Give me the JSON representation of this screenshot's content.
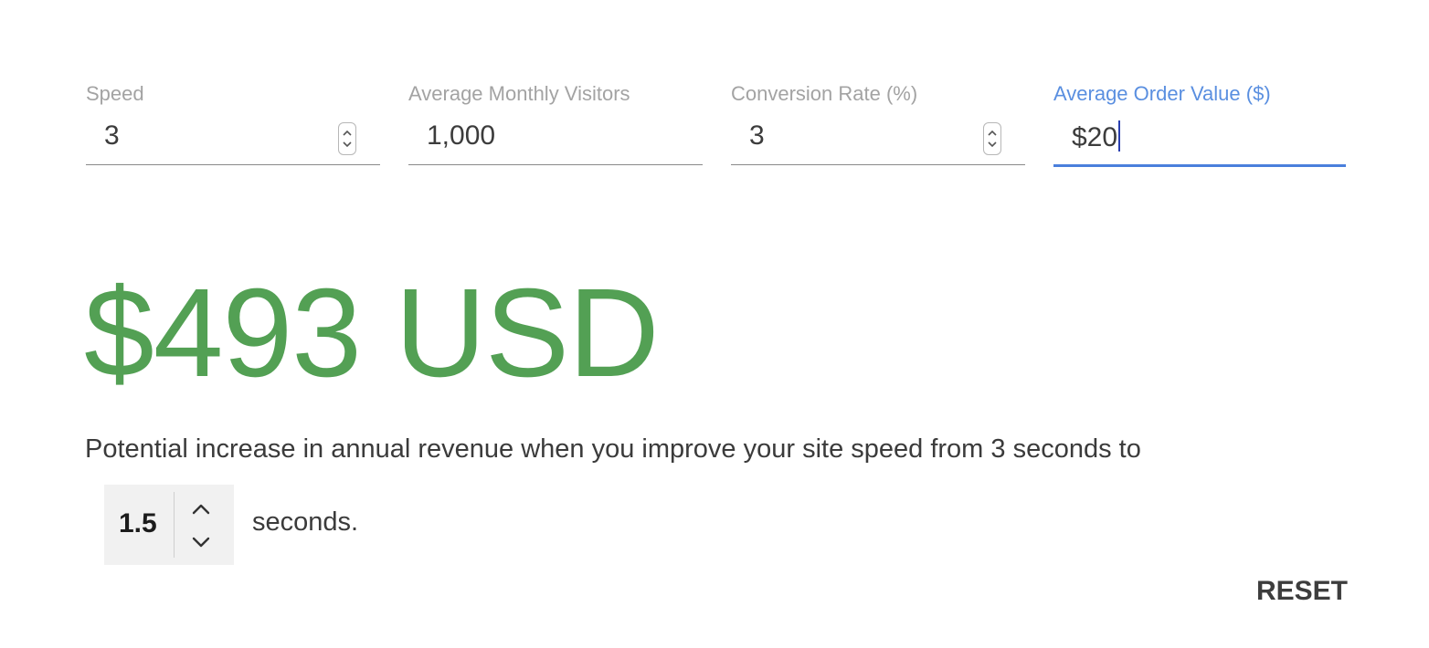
{
  "fields": [
    {
      "label": "Speed",
      "value": "3",
      "has_spinner": true,
      "focused": false
    },
    {
      "label": "Average Monthly Visitors",
      "value": "1,000",
      "has_spinner": false,
      "focused": false
    },
    {
      "label": "Conversion Rate (%)",
      "value": "3",
      "has_spinner": true,
      "focused": false
    },
    {
      "label": "Average Order Value ($)",
      "value": "$20",
      "has_spinner": false,
      "focused": true
    }
  ],
  "result": {
    "amount": "$493 USD"
  },
  "description": "Potential increase in annual revenue when you improve your site speed from 3 seconds to",
  "target_speed": {
    "value": "1.5",
    "suffix": "seconds."
  },
  "reset_label": "RESET",
  "colors": {
    "result_green": "#53a054",
    "focus_blue": "#4a7fdc"
  }
}
